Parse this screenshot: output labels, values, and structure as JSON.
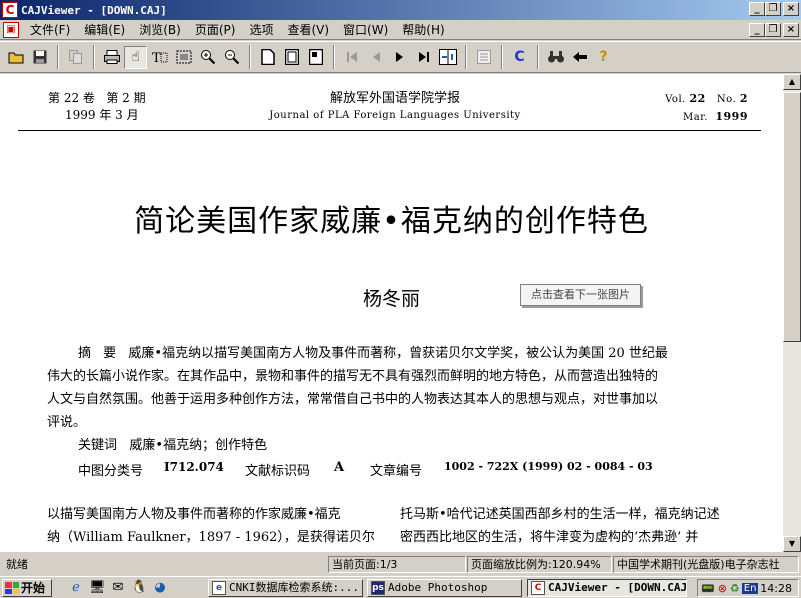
{
  "window": {
    "title": "CAJViewer - [DOWN.CAJ]",
    "controls": [
      "_",
      "🗗",
      "×"
    ]
  },
  "menu": {
    "items": [
      "文件(F)",
      "编辑(E)",
      "浏览(B)",
      "页面(P)",
      "选项",
      "查看(V)",
      "窗口(W)",
      "帮助(H)"
    ]
  },
  "toolbar": {
    "icons": [
      "open-icon",
      "save-icon",
      "copy-icon",
      "print-icon",
      "hand-icon",
      "text-select-icon",
      "image-select-icon",
      "zoom-in-icon",
      "zoom-out-icon",
      "single-page-icon",
      "fit-page-icon",
      "fit-width-icon",
      "first-page-icon",
      "prev-page-icon",
      "next-page-icon",
      "last-page-icon",
      "goto-page-icon",
      "notes-icon",
      "c-icon",
      "find-icon",
      "back-icon",
      "help-icon"
    ],
    "c_label": "C",
    "help_label": "?"
  },
  "document": {
    "header": {
      "volume": "第 22 卷",
      "issue": "第 2 期",
      "date": "1999 年 3 月",
      "journal_zh": "解放军外国语学院学报",
      "journal_en": "Journal of PLA Foreign Languages University",
      "vol_en_label": "Vol.",
      "vol_en_value": "22",
      "no_en_label": "No.",
      "no_en_value": "2",
      "date_en_month": "Mar.",
      "date_en_year": "1999"
    },
    "title": "简论美国作家威廉•福克纳的创作特色",
    "author": "杨冬丽",
    "tooltip": "点击查看下一张图片",
    "abstract_label": "摘 要",
    "abstract_lines": [
      "威廉•福克纳以描写美国南方人物及事件而著称，曾获诺贝尔文学奖，被公认为美国 20 世纪最",
      "伟大的长篇小说作家。在其作品中，景物和事件的描写无不具有强烈而鲜明的地方特色，从而营造出独特的",
      "人文与自然氛围。他善于运用多种创作方法，常常借自己书中的人物表达其本人的思想与观点，对世事加以",
      "评说。"
    ],
    "keywords_label": "关键词",
    "keywords": "威廉•福克纳；创作特色",
    "clc_label": "中图分类号",
    "clc_value": "I712.074",
    "doc_id_label": "文献标识码",
    "doc_id_value": "A",
    "article_no_label": "文章编号",
    "article_no_value": "1002 - 722X (1999) 02 - 0084 - 03",
    "body_left_1": "以描写美国南方人物及事件而著称的作家威廉•福克",
    "body_left_2": "纳（William Faulkner，1897 - 1962），是获得诺贝尔文学",
    "body_right_1": "托马斯•哈代记述英国西部乡村的生活一样，福克纳记述",
    "body_right_2": "密西西比地区的生活，将牛津变为虚构的‘杰弗逊’ 并"
  },
  "statusbar": {
    "ready": "就绪",
    "current_page": "当前页面:1/3",
    "zoom": "页面缩放比例为:120.94%",
    "publisher": "中国学术期刊(光盘版)电子杂志社"
  },
  "taskbar": {
    "start": "开始",
    "tasks": [
      {
        "label": "CNKI数据库检索系统:...",
        "icon": "ie-icon",
        "active": false
      },
      {
        "label": "Adobe Photoshop",
        "icon": "photoshop-icon",
        "active": false
      },
      {
        "label": "CAJViewer - [DOWN.CAJ]",
        "icon": "caj-icon",
        "active": true
      }
    ],
    "tray_lang": "En",
    "clock": "14:28"
  }
}
